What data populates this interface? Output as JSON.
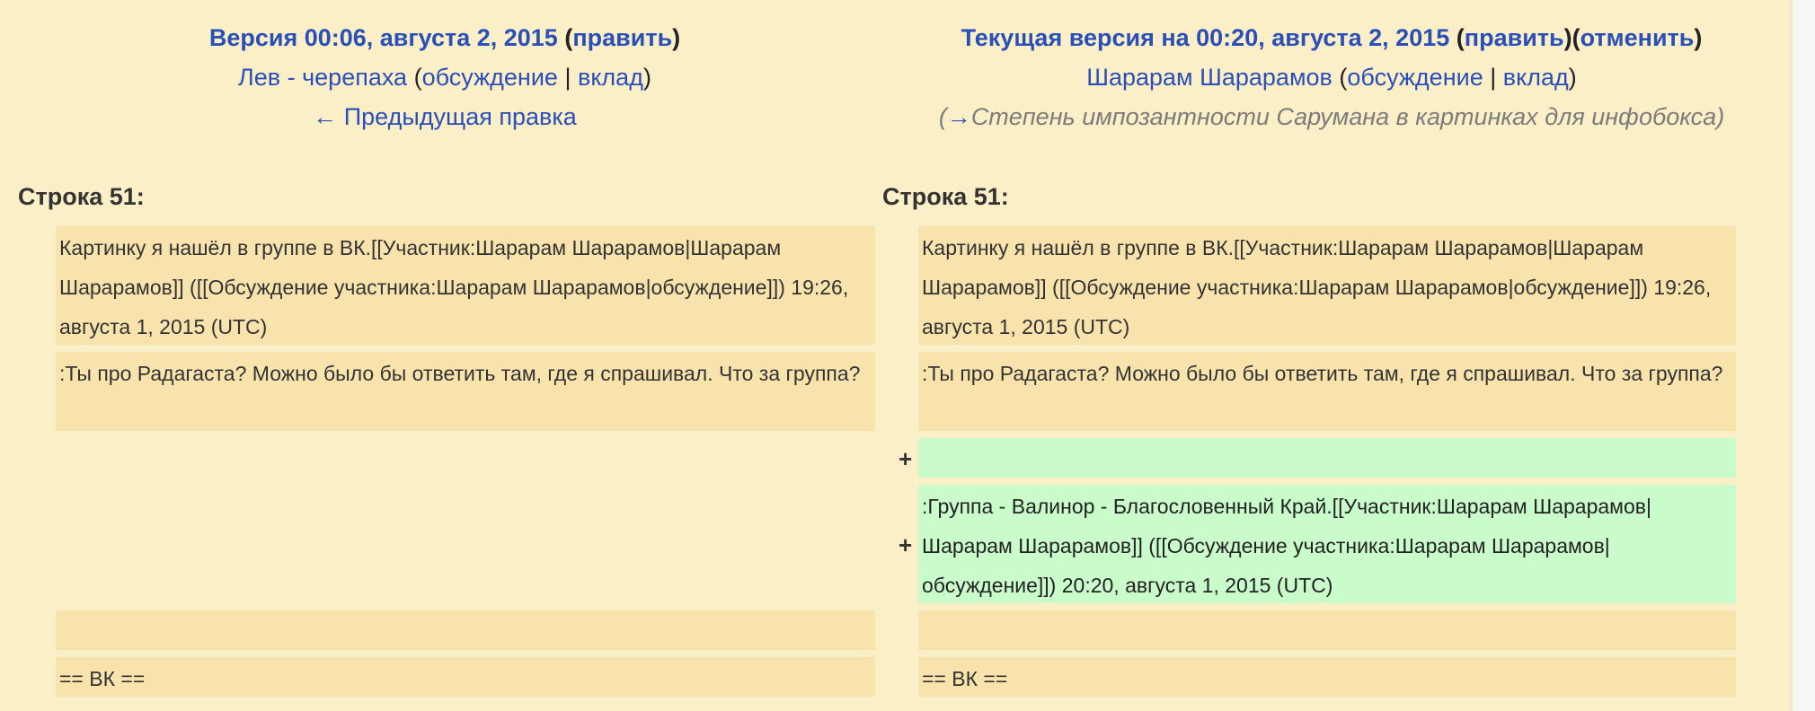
{
  "left_header": {
    "title": "Версия 00:06, августа 2, 2015",
    "edit_link": "править",
    "user": "Лев - черепаха",
    "talk_link": "обсуждение",
    "separator": "|",
    "contrib_link": "вклад",
    "prev_link": "← Предыдущая правка"
  },
  "right_header": {
    "title": "Текущая версия на 00:20, августа 2, 2015",
    "edit_link": "править",
    "undo_link": "отменить",
    "user": "Шарарам Шарарамов",
    "talk_link": "обсуждение",
    "separator": "|",
    "contrib_link": "вклад",
    "summary_arrow": "→",
    "summary_text": "Степень импозантности Сарумана в картинках для инфобокса"
  },
  "diff": {
    "line_label_left": "Строка 51:",
    "line_label_right": "Строка 51:",
    "context_1": "Картинку я нашёл в группе в ВК.[[Участник:Шарарам Шарарамов|Шарарам Шарарамов]] ([[Обсуждение участника:Шарарам Шарарамов|обсуждение]]) 19:26, августа 1, 2015 (UTC)",
    "context_2": ":Ты про Радагаста? Можно было бы ответить там, где я спрашивал. Что за группа?",
    "added_1": "",
    "added_2": ":Группа - Валинор - Благословенный Край.[[Участник:Шарарам Шарарамов|Шарарам Шарарамов]] ([[Обсуждение участника:Шарарам Шарарамов|обсуждение]]) 20:20, августа 1, 2015 (UTC)",
    "context_3": "",
    "context_4": "== ВК ==",
    "plus_marker": "+"
  }
}
